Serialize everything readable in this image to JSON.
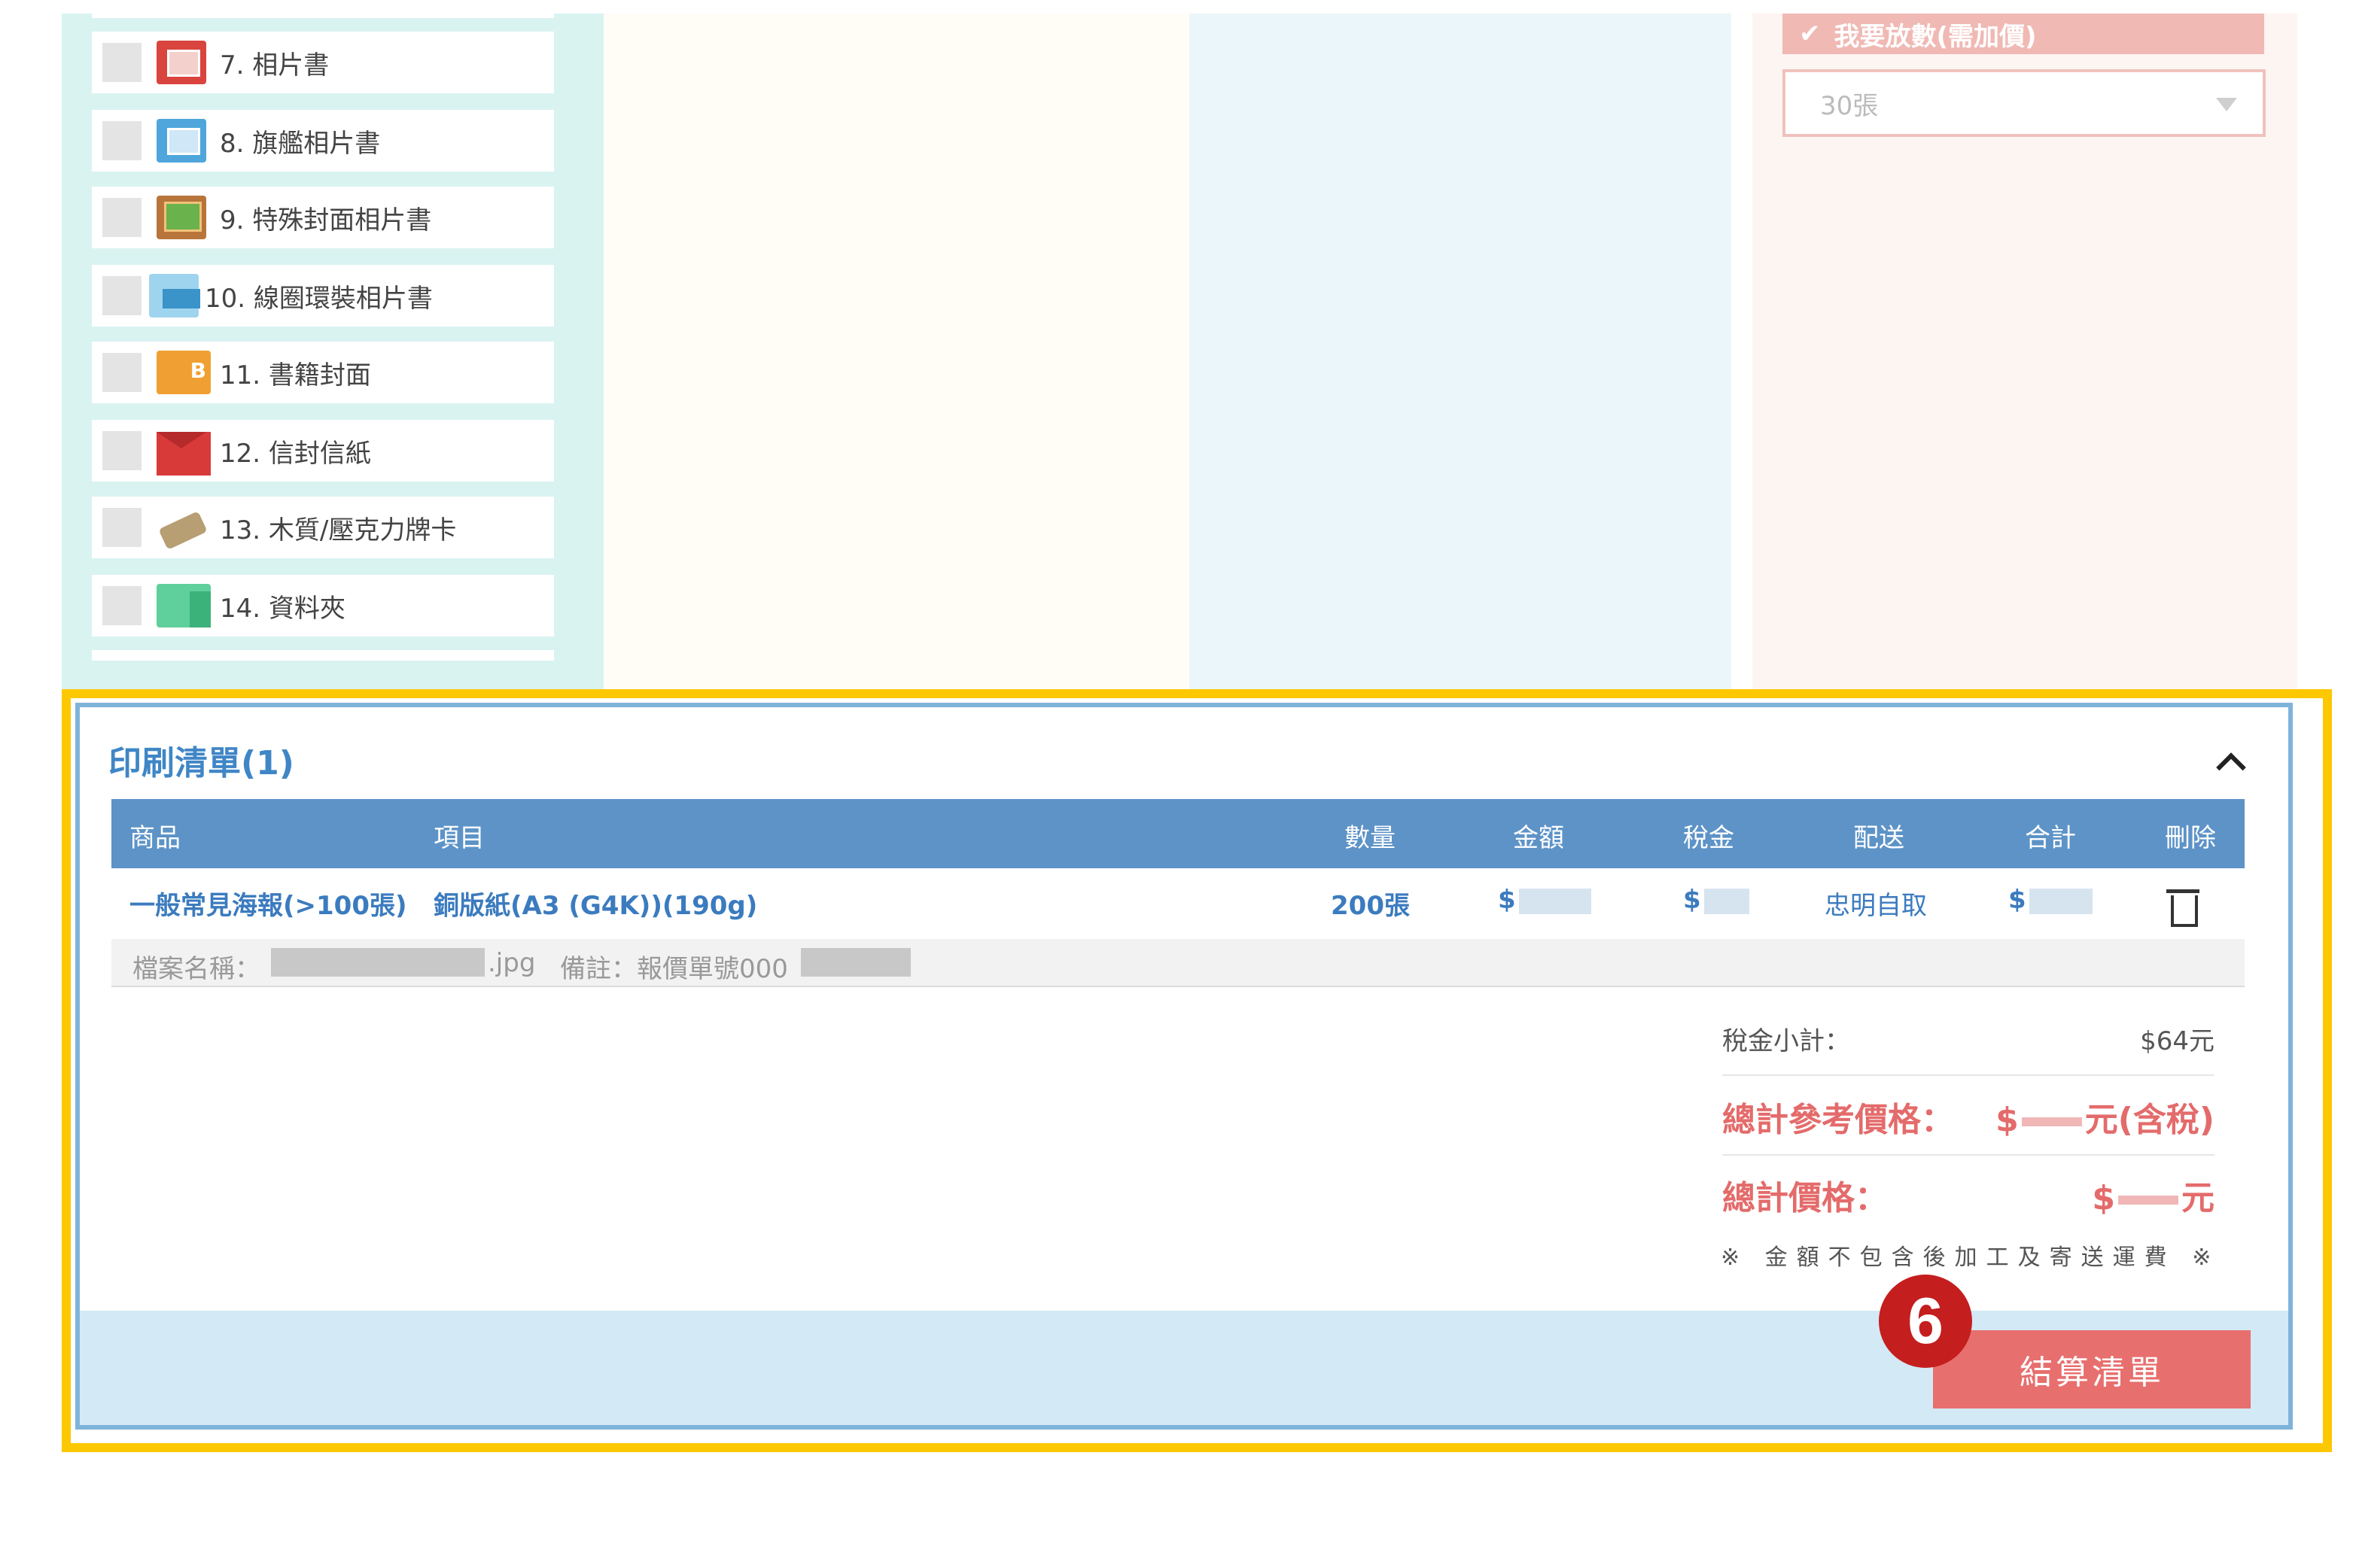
{
  "product_list": {
    "items": [
      {
        "label": "7. 相片書",
        "icon": "photo-book-icon"
      },
      {
        "label": "8. 旗艦相片書",
        "icon": "flagship-photo-book-icon"
      },
      {
        "label": "9. 特殊封面相片書",
        "icon": "special-cover-photo-book-icon"
      },
      {
        "label": "10. 線圈環裝相片書",
        "icon": "coil-bound-photo-book-icon"
      },
      {
        "label": "11. 書籍封面",
        "icon": "book-cover-icon"
      },
      {
        "label": "12. 信封信紙",
        "icon": "envelope-icon"
      },
      {
        "label": "13. 木質/壓克力牌卡",
        "icon": "wooden-tag-icon"
      },
      {
        "label": "14. 資料夾",
        "icon": "folder-icon"
      }
    ]
  },
  "options": {
    "upgrade_label": "我要放數(需加價)",
    "quantity_select": "30張"
  },
  "print_list": {
    "title": "印刷清單(1)",
    "columns": [
      "商品",
      "項目",
      "數量",
      "金額",
      "稅金",
      "配送",
      "合計",
      "刪除"
    ],
    "row": {
      "product": "一般常見海報(>100張)",
      "item": "銅版紙(A3 (G4K))(190g)",
      "quantity": "200張",
      "amount": "$",
      "tax": "$",
      "delivery": "忠明自取",
      "total": "$"
    },
    "file_label": "檔案名稱：",
    "file_ext": ".jpg",
    "note_label": "備註：報價單號000"
  },
  "summary": {
    "tax_subtotal_label": "稅金小計：",
    "tax_subtotal_value": "$64元",
    "reference_price_label": "總計參考價格：",
    "reference_price_prefix": "$",
    "reference_price_suffix": "元(含稅)",
    "total_price_label": "總計價格：",
    "total_price_prefix": "$",
    "total_price_suffix": "元",
    "note": "※ 金額不包含後加工及寄送運費 ※"
  },
  "checkout": {
    "button_label": "結算清單",
    "step_number": "6"
  },
  "colors": {
    "highlight": "#fdc800",
    "header": "#5d93c7",
    "accent_red": "#e76f6e",
    "badge": "#c41e1e"
  }
}
